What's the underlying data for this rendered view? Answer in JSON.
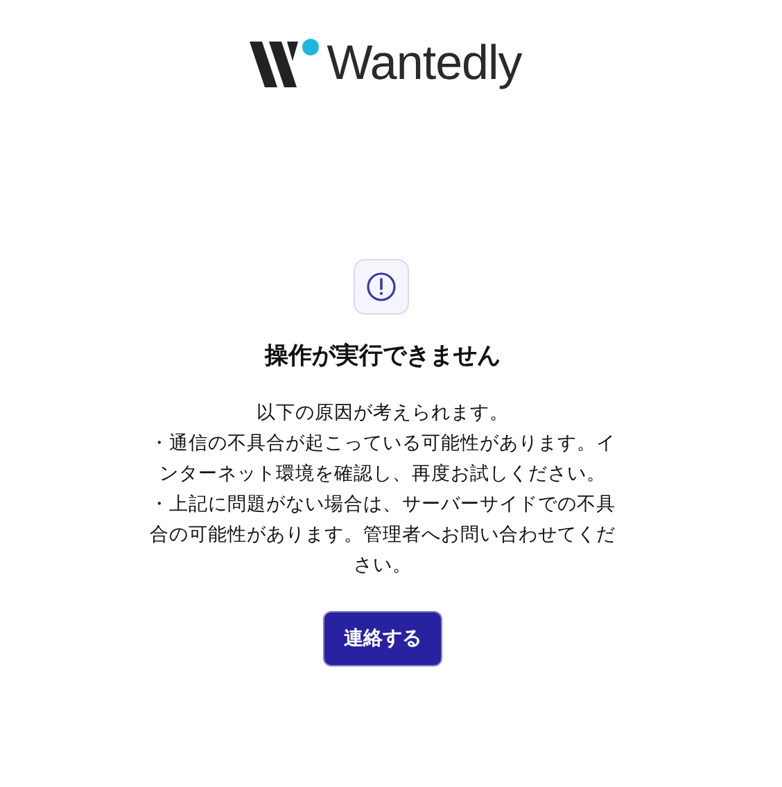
{
  "logo": {
    "text": "Wantedly"
  },
  "error": {
    "title": "操作が実行できません",
    "message": [
      "以下の原因が考えられます。",
      "・通信の不具合が起こっている可能性があります。インターネット環境を確認し、再度お試しください。",
      "・上記に問題がない場合は、サーバーサイドでの不具合の可能性があります。管理者へお問い合わせてください。"
    ]
  },
  "buttons": [
    "連絡する"
  ]
}
